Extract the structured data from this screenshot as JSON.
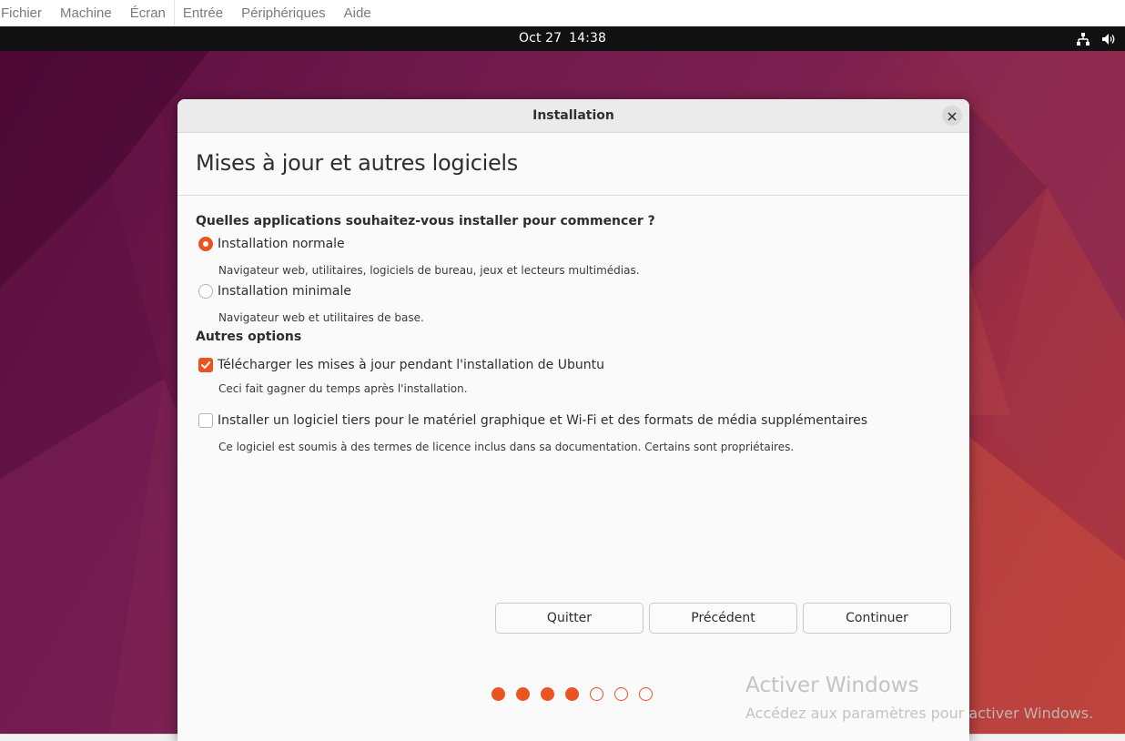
{
  "vbox_menu": [
    "Fichier",
    "Machine",
    "Écran",
    "Entrée",
    "Périphériques",
    "Aide"
  ],
  "topbar": {
    "date": "Oct 27",
    "time": "14:38"
  },
  "window": {
    "title": "Installation"
  },
  "page": {
    "heading": "Mises à jour et autres logiciels",
    "question": "Quelles applications souhaitez-vous installer pour commencer ?",
    "options": [
      {
        "label": "Installation normale",
        "description": "Navigateur web, utilitaires, logiciels de bureau, jeux et lecteurs multimédias.",
        "selected": true
      },
      {
        "label": "Installation minimale",
        "description": "Navigateur web et utilitaires de base.",
        "selected": false
      }
    ],
    "other_title": "Autres options",
    "checks": [
      {
        "label": "Télécharger les mises à jour pendant l'installation de Ubuntu",
        "description": "Ceci fait gagner du temps après l'installation.",
        "checked": true
      },
      {
        "label": "Installer un logiciel tiers pour le matériel graphique et Wi-Fi et des formats de média supplémentaires",
        "description": "Ce logiciel est soumis à des termes de licence inclus dans sa documentation. Certains sont propriétaires.",
        "checked": false
      }
    ]
  },
  "buttons": {
    "quit": "Quitter",
    "back": "Précédent",
    "continue": "Continuer"
  },
  "progress": {
    "total_steps": 7,
    "completed_steps": 4
  },
  "watermark": {
    "title": "Activer Windows",
    "subtitle": "Accédez aux paramètres pour activer Windows."
  },
  "colors": {
    "accent": "#e95420",
    "topbar": "#111111",
    "wallpaper": "#6e1a4b"
  },
  "icons": {
    "network": "network-icon",
    "volume": "volume-icon",
    "close": "close-icon",
    "check": "checkmark-icon"
  }
}
